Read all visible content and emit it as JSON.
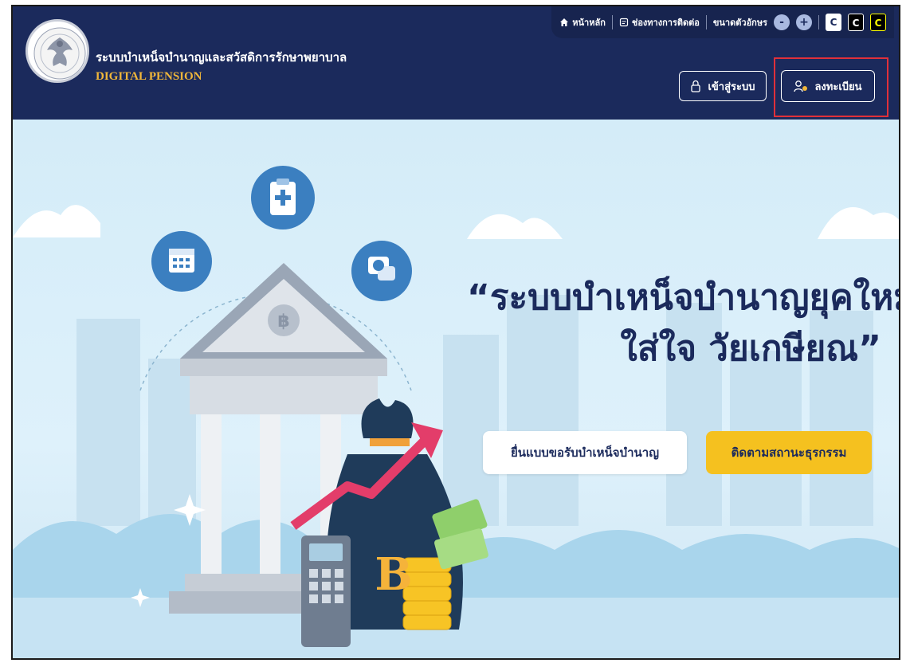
{
  "header": {
    "system_name_th": "ระบบบำเหน็จบำนาญและสวัสดิการรักษาพยาบาล",
    "system_name_en": "DIGITAL PENSION",
    "logo_text": "กรมบัญชีกลาง",
    "topnav": {
      "home": "หน้าหลัก",
      "contact": "ช่องทางการติดต่อ",
      "font_size": "ขนาดตัวอักษร",
      "decrease": "-",
      "increase": "+",
      "contrast_labels": [
        "C",
        "C",
        "C"
      ]
    },
    "login_label": "เข้าสู่ระบบ",
    "register_label": "ลงทะเบียน"
  },
  "hero": {
    "headline_line1": "“ระบบบำเหน็จบำนาญยุคใหม่",
    "headline_line2": "ใส่ใจ วัยเกษียณ”",
    "cta_submit": "ยื่นแบบขอรับบำเหน็จบำนาญ",
    "cta_track": "ติดตามสถานะธุรกรรม",
    "illustration": {
      "bank_symbol": "฿",
      "bag_symbol": "B"
    }
  },
  "colors": {
    "header_bg": "#1b2a5c",
    "accent_gold": "#f1b73a",
    "cta_yellow": "#f5c11f",
    "highlight_red": "#e0303a",
    "sky": "#d9eef8"
  },
  "icons": [
    "home-icon",
    "contact-icon",
    "lock-icon",
    "user-plus-icon",
    "calendar-icon",
    "clipboard-medical-icon",
    "chat-coin-icon"
  ]
}
